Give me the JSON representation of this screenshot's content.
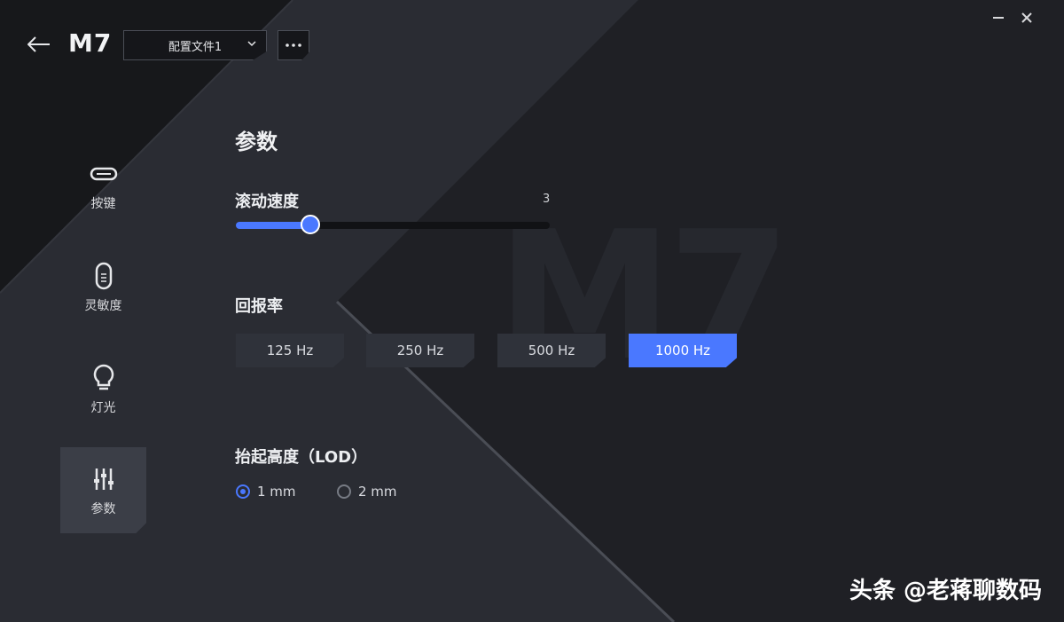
{
  "header": {
    "app_title": "M7",
    "profile": "配置文件1"
  },
  "sidebar": {
    "items": [
      {
        "label": "按键",
        "icon": "mouse-button-icon",
        "active": false
      },
      {
        "label": "灵敏度",
        "icon": "mouse-icon",
        "active": false
      },
      {
        "label": "灯光",
        "icon": "lightbulb-icon",
        "active": false
      },
      {
        "label": "参数",
        "icon": "sliders-icon",
        "active": true
      }
    ]
  },
  "main": {
    "title": "参数",
    "scroll_speed": {
      "label": "滚动速度",
      "value": "3",
      "fraction": 0.24
    },
    "polling_rate": {
      "label": "回报率",
      "options": [
        "125 Hz",
        "250 Hz",
        "500 Hz",
        "1000 Hz"
      ],
      "selected": "1000 Hz"
    },
    "lod": {
      "label": "抬起高度（LOD）",
      "options": [
        "1 mm",
        "2 mm"
      ],
      "selected": "1 mm"
    }
  },
  "background_mark": "M7",
  "watermark": "头条 @老蒋聊数码",
  "colors": {
    "accent": "#4a78ff",
    "background": "#1c1d21",
    "panel": "#2f323a"
  }
}
